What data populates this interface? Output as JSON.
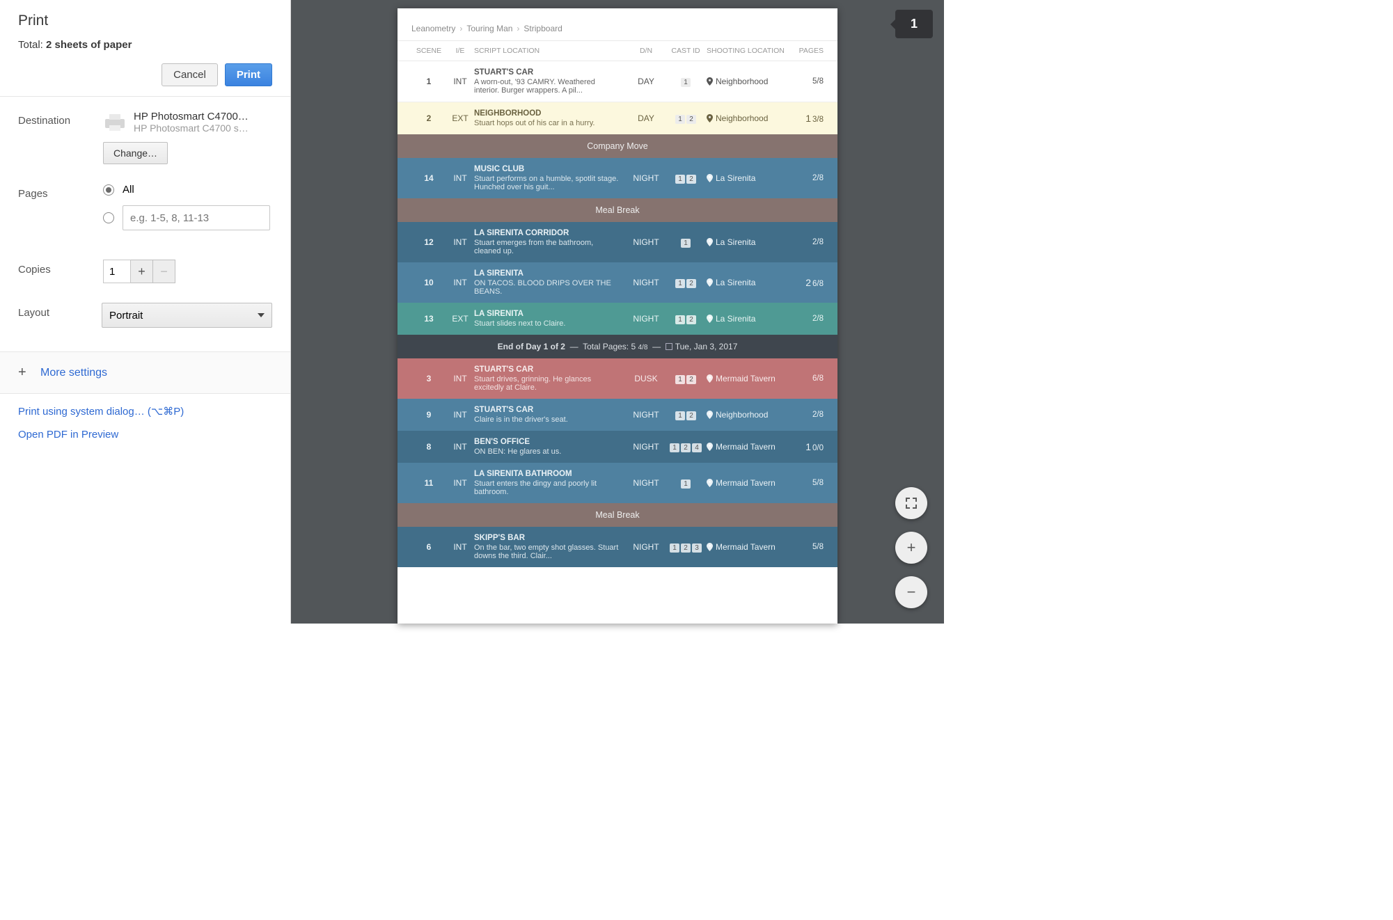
{
  "sidebar": {
    "title": "Print",
    "total_prefix": "Total: ",
    "total_value": "2 sheets of paper",
    "cancel": "Cancel",
    "print": "Print",
    "destination_label": "Destination",
    "printer_name": "HP Photosmart C4700…",
    "printer_sub": "HP Photosmart C4700 s…",
    "change": "Change…",
    "pages_label": "Pages",
    "pages_all": "All",
    "pages_placeholder": "e.g. 1-5, 8, 11-13",
    "copies_label": "Copies",
    "copies_value": "1",
    "layout_label": "Layout",
    "layout_value": "Portrait",
    "more_settings": "More settings",
    "system_dialog": "Print using system dialog… (⌥⌘P)",
    "open_pdf": "Open PDF in Preview"
  },
  "preview": {
    "page_indicator": "1"
  },
  "doc": {
    "crumbs": [
      "Leanometry",
      "Touring Man",
      "Stripboard"
    ],
    "headers": {
      "scene": "SCENE",
      "ie": "I/E",
      "loc": "SCRIPT LOCATION",
      "dn": "D/N",
      "cast": "CAST ID",
      "shoot": "SHOOTING LOCATION",
      "pages": "PAGES"
    },
    "rows": [
      {
        "type": "strip",
        "color": "white",
        "scene": "1",
        "ie": "INT",
        "title": "STUART'S CAR",
        "desc": "A worn-out, '93 CAMRY. Weathered interior. Burger wrappers. A pil...",
        "dn": "DAY",
        "cast": [
          "1"
        ],
        "shoot": "Neighborhood",
        "pages": "5/8"
      },
      {
        "type": "strip",
        "color": "cream",
        "scene": "2",
        "ie": "EXT",
        "title": "NEIGHBORHOOD",
        "desc": "Stuart hops out of his car in a hurry.",
        "dn": "DAY",
        "cast": [
          "1",
          "2"
        ],
        "shoot": "Neighborhood",
        "pages_big": "1",
        "pages": "3/8"
      },
      {
        "type": "banner",
        "color": "brown",
        "text": "Company Move"
      },
      {
        "type": "strip",
        "color": "blue",
        "scene": "14",
        "ie": "INT",
        "title": "MUSIC CLUB",
        "desc": "Stuart performs on a humble, spotlit stage. Hunched over his guit...",
        "dn": "NIGHT",
        "cast": [
          "1",
          "2"
        ],
        "shoot": "La Sirenita",
        "pages": "2/8"
      },
      {
        "type": "banner",
        "color": "brown",
        "text": "Meal Break"
      },
      {
        "type": "strip",
        "color": "bluedark",
        "scene": "12",
        "ie": "INT",
        "title": "LA SIRENITA CORRIDOR",
        "desc": "Stuart emerges from the bathroom, cleaned up.",
        "dn": "NIGHT",
        "cast": [
          "1"
        ],
        "shoot": "La Sirenita",
        "pages": "2/8"
      },
      {
        "type": "strip",
        "color": "blue",
        "scene": "10",
        "ie": "INT",
        "title": "LA SIRENITA",
        "desc": "ON TACOS. BLOOD DRIPS OVER THE BEANS.",
        "dn": "NIGHT",
        "cast": [
          "1",
          "2"
        ],
        "shoot": "La Sirenita",
        "pages_big": "2",
        "pages": "6/8"
      },
      {
        "type": "strip",
        "color": "teal",
        "scene": "13",
        "ie": "EXT",
        "title": "LA SIRENITA",
        "desc": "Stuart slides next to Claire.",
        "dn": "NIGHT",
        "cast": [
          "1",
          "2"
        ],
        "shoot": "La Sirenita",
        "pages": "2/8"
      },
      {
        "type": "banner",
        "color": "dark",
        "text_html": {
          "a": "End of Day 1 of 2",
          "b": "Total Pages: 5",
          "b2": "4/8",
          "c": "Tue, Jan 3, 2017"
        }
      },
      {
        "type": "strip",
        "color": "red",
        "scene": "3",
        "ie": "INT",
        "title": "STUART'S CAR",
        "desc": "Stuart drives, grinning. He glances excitedly at Claire.",
        "dn": "DUSK",
        "cast": [
          "1",
          "2"
        ],
        "shoot": "Mermaid Tavern",
        "pages": "6/8"
      },
      {
        "type": "strip",
        "color": "blue",
        "scene": "9",
        "ie": "INT",
        "title": "STUART'S CAR",
        "desc": "Claire is in the driver's seat.",
        "dn": "NIGHT",
        "cast": [
          "1",
          "2"
        ],
        "shoot": "Neighborhood",
        "pages": "2/8"
      },
      {
        "type": "strip",
        "color": "bluedark",
        "scene": "8",
        "ie": "INT",
        "title": "BEN'S OFFICE",
        "desc": "ON BEN: He glares at us.",
        "dn": "NIGHT",
        "cast": [
          "1",
          "2",
          "4"
        ],
        "shoot": "Mermaid Tavern",
        "pages_big": "1",
        "pages": "0/0"
      },
      {
        "type": "strip",
        "color": "blue",
        "scene": "11",
        "ie": "INT",
        "title": "LA SIRENITA BATHROOM",
        "desc": "Stuart enters the dingy and poorly lit bathroom.",
        "dn": "NIGHT",
        "cast": [
          "1"
        ],
        "shoot": "Mermaid Tavern",
        "pages": "5/8"
      },
      {
        "type": "banner",
        "color": "brown",
        "text": "Meal Break"
      },
      {
        "type": "strip",
        "color": "bluedark",
        "scene": "6",
        "ie": "INT",
        "title": "SKIPP'S BAR",
        "desc": "On the bar, two empty shot glasses. Stuart downs the third. Clair...",
        "dn": "NIGHT",
        "cast": [
          "1",
          "2",
          "3"
        ],
        "shoot": "Mermaid Tavern",
        "pages": "5/8"
      }
    ]
  }
}
